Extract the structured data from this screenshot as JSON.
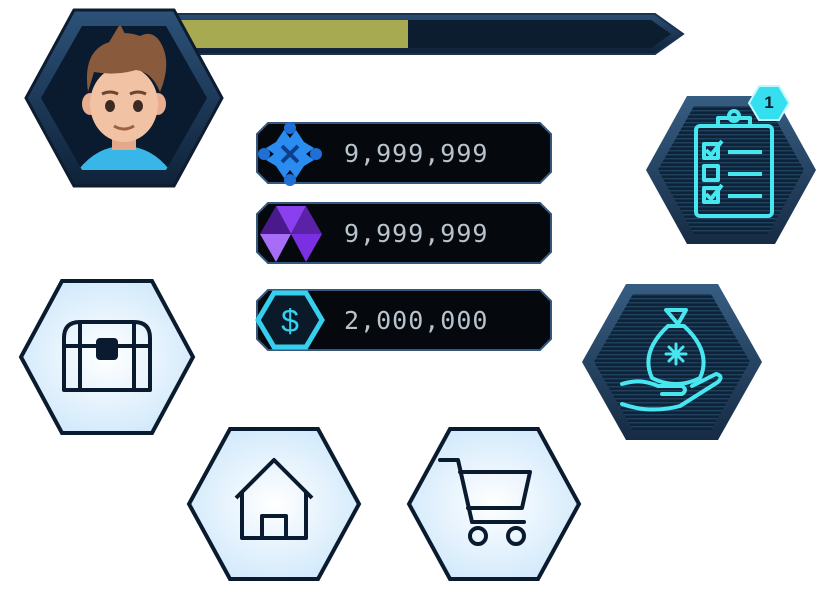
{
  "player": {
    "avatar_icon": "player-avatar-portrait",
    "xp_progress": 0.49
  },
  "currencies": [
    {
      "name": "blue-gem",
      "icon": "blue-star-gem-icon",
      "amount": "9,999,999",
      "color": "#2a8cf0"
    },
    {
      "name": "purple-crystal",
      "icon": "purple-triangle-crystal-icon",
      "amount": "9,999,999",
      "color": "#8a3ff0"
    },
    {
      "name": "cash",
      "icon": "dollar-hexagon-icon",
      "amount": "2,000,000",
      "color": "#36d0ee"
    }
  ],
  "buttons": {
    "quests": {
      "icon": "clipboard-checklist-icon",
      "badge": "1"
    },
    "rewards": {
      "icon": "money-bag-hand-icon"
    },
    "chest": {
      "icon": "treasure-chest-icon"
    },
    "home": {
      "icon": "home-icon"
    },
    "shop": {
      "icon": "shopping-cart-icon"
    }
  },
  "colors": {
    "dark_navy": "#0b1b2f",
    "panel_border": "#2a4b70",
    "neon_cyan": "#48e6ee",
    "light_hex_fill": "#dff1ff",
    "xp_fill": "#a8aa52"
  }
}
